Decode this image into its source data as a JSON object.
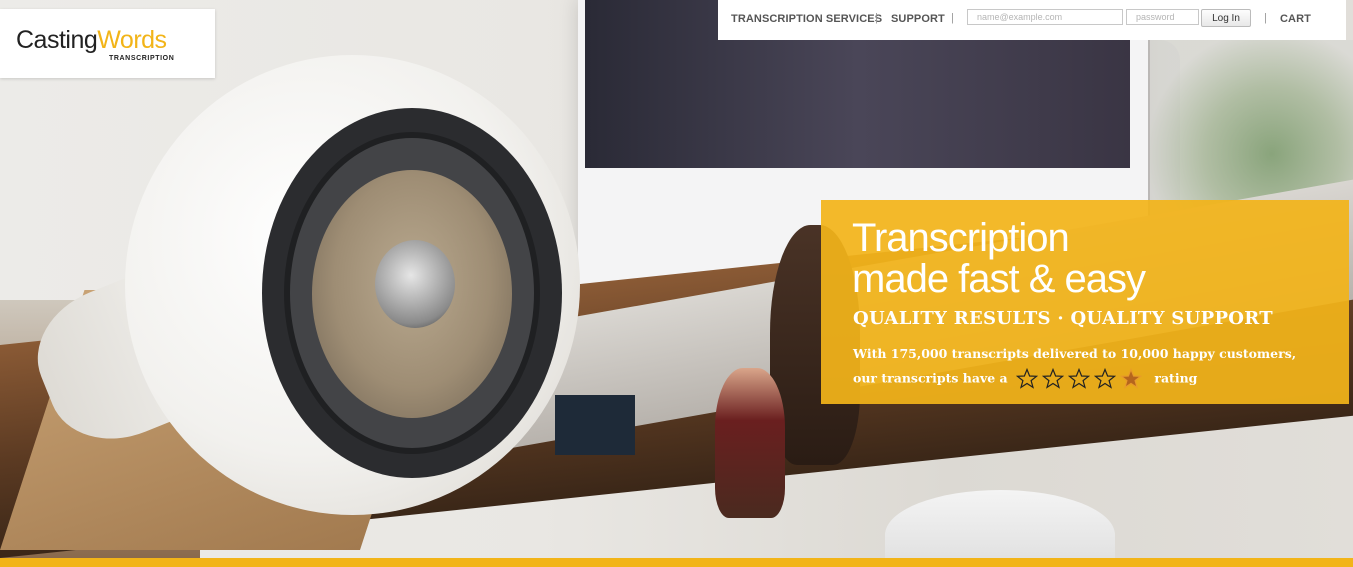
{
  "logo": {
    "casting": "Casting",
    "words": "Words",
    "subtitle": "TRANSCRIPTION"
  },
  "nav": {
    "services_label": "TRANSCRIPTION SERVICES",
    "support_label": "SUPPORT",
    "separator": "|",
    "email_placeholder": "name@example.com",
    "password_placeholder": "password",
    "login_label": "Log In",
    "cart_label": "CART"
  },
  "promo": {
    "headline_line1": "Transcription",
    "headline_line2": "made fast & easy",
    "tagline": "QUALITY RESULTS · QUALITY SUPPORT",
    "body_prefix": "With 175,000 transcripts delivered to 10,000 happy customers, our transcripts have a",
    "body_suffix": "rating",
    "rating": {
      "filled": 4.5,
      "max": 5
    }
  },
  "colors": {
    "accent": "#f2b418",
    "promo_bg": "#f2b41a",
    "nav_text": "#555555"
  },
  "icons": {
    "star": "star-icon"
  }
}
